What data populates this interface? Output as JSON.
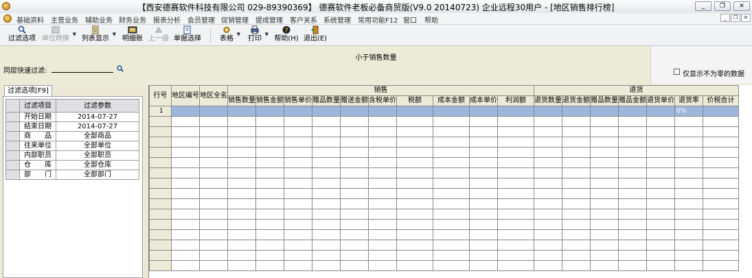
{
  "window": {
    "title": "【西安德赛软件科技有限公司 029-89390369】 德赛软件老板必备商贸版(V9.0 20140723) 企业远程30用户 - [地区销售排行榜]",
    "controls": [
      "_",
      "❐",
      "✕"
    ]
  },
  "menu": {
    "items": [
      "基础资料",
      "主营业务",
      "辅助业务",
      "财务业务",
      "报表分析",
      "会员管理",
      "促销管理",
      "提成管理",
      "客户关系",
      "系统管理",
      "常用功能F12",
      "窗口",
      "帮助"
    ]
  },
  "toolbar": {
    "filter": "过滤选项",
    "unit_convert": "单位转换",
    "list_display": "列表显示",
    "detail": "明细账",
    "up_level": "上一级",
    "single_select": "单据选择",
    "table": "表格",
    "print": "打印",
    "help": "帮助(H)",
    "exit": "退出(E)"
  },
  "report": {
    "subtitle": "小于销售数量",
    "quick_filter_label": "同层快速过滤:",
    "only_nonzero_label": "仅显示不为零的数据"
  },
  "filter_panel": {
    "tab_label": "过滤选项[F9]",
    "header_item": "过滤项目",
    "header_param": "过滤参数",
    "rows": [
      {
        "item": "开始日期",
        "value": "2014-07-27"
      },
      {
        "item": "结束日期",
        "value": "2014-07-27"
      },
      {
        "item": "商　　品",
        "value": "全部商品"
      },
      {
        "item": "往来单位",
        "value": "全部单位"
      },
      {
        "item": "内部职员",
        "value": "全部职员"
      },
      {
        "item": "仓　　库",
        "value": "全部仓库"
      },
      {
        "item": "部　　门",
        "value": "全部部门"
      }
    ]
  },
  "grid": {
    "row_no": "行号",
    "region_code": "地区编号",
    "region_name": "地区全名",
    "sales_group": "销售",
    "sales_cols": [
      "销售数量",
      "销售金额",
      "销售单价",
      "赠品数量",
      "赠送金额",
      "含税单价",
      "税额",
      "成本金额",
      "成本单价",
      "利润额"
    ],
    "return_group": "退货",
    "return_cols": [
      "退货数量",
      "退货金额",
      "赠品数量",
      "赠品金额",
      "退货单价",
      "退货率",
      "价税合计"
    ],
    "first_row": {
      "no": "1",
      "return_rate": "0%"
    }
  }
}
